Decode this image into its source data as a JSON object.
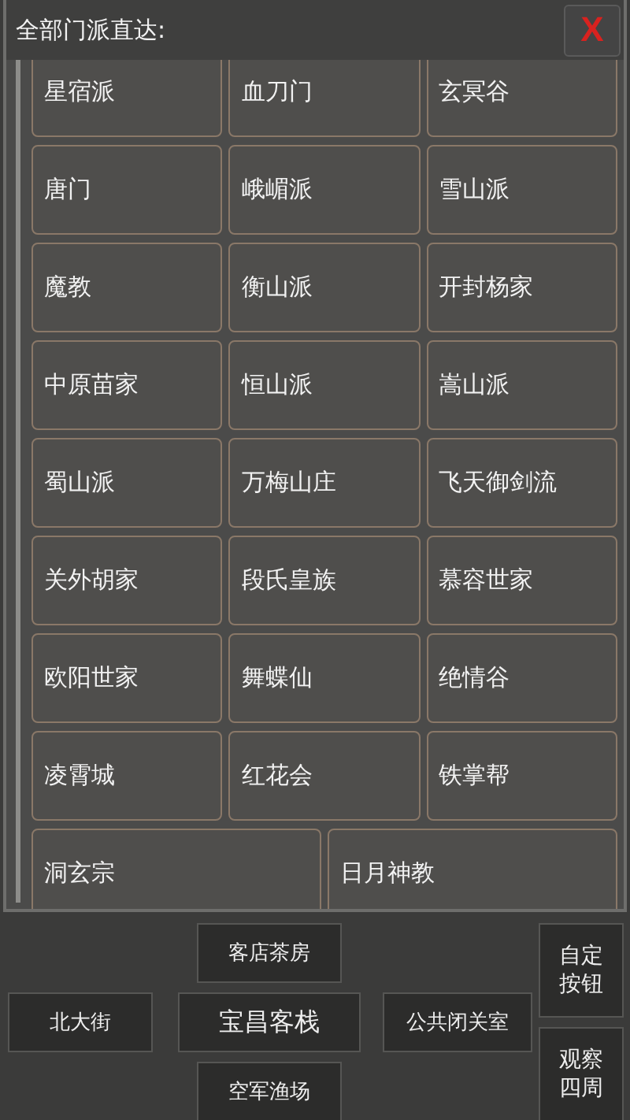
{
  "dialog": {
    "title": "全部门派直达:",
    "close": "X"
  },
  "sects": [
    {
      "label": "星宿派",
      "kind": "regular"
    },
    {
      "label": "血刀门",
      "kind": "regular"
    },
    {
      "label": "玄冥谷",
      "kind": "regular"
    },
    {
      "label": "唐门",
      "kind": "regular"
    },
    {
      "label": "峨嵋派",
      "kind": "regular"
    },
    {
      "label": "雪山派",
      "kind": "regular"
    },
    {
      "label": "魔教",
      "kind": "regular"
    },
    {
      "label": "衡山派",
      "kind": "regular"
    },
    {
      "label": "开封杨家",
      "kind": "regular"
    },
    {
      "label": "中原苗家",
      "kind": "regular"
    },
    {
      "label": "恒山派",
      "kind": "regular"
    },
    {
      "label": "嵩山派",
      "kind": "regular"
    },
    {
      "label": "蜀山派",
      "kind": "regular"
    },
    {
      "label": "万梅山庄",
      "kind": "regular"
    },
    {
      "label": "飞天御剑流",
      "kind": "regular"
    },
    {
      "label": "关外胡家",
      "kind": "regular"
    },
    {
      "label": "段氏皇族",
      "kind": "regular"
    },
    {
      "label": "慕容世家",
      "kind": "regular"
    },
    {
      "label": "欧阳世家",
      "kind": "regular"
    },
    {
      "label": "舞蝶仙",
      "kind": "regular"
    },
    {
      "label": "绝情谷",
      "kind": "regular"
    },
    {
      "label": "凌霄城",
      "kind": "regular"
    },
    {
      "label": "红花会",
      "kind": "regular"
    },
    {
      "label": "铁掌帮",
      "kind": "regular"
    },
    {
      "label": "洞玄宗",
      "kind": "wide"
    },
    {
      "label": "日月神教",
      "kind": "wide"
    }
  ],
  "exits": {
    "north": "客店茶房",
    "west": "北大街",
    "center": "宝昌客栈",
    "east": "公共闭关室",
    "south": "空军渔场"
  },
  "side_buttons": [
    "自定按钮",
    "观察四周"
  ]
}
